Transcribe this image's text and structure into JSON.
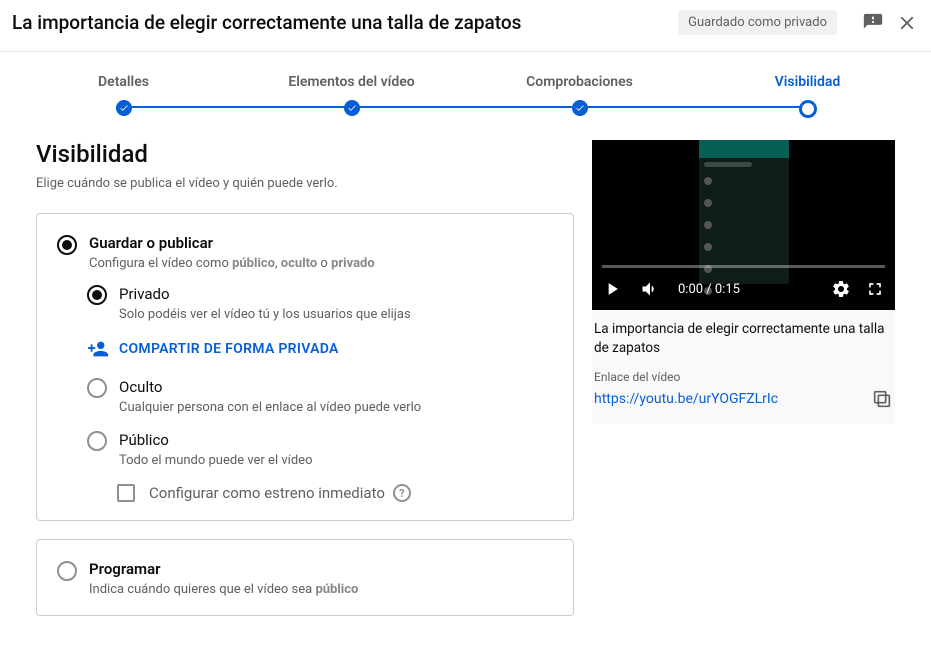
{
  "header": {
    "title": "La importancia de elegir correctamente una talla de zapatos",
    "saved_chip": "Guardado como privado"
  },
  "stepper": {
    "steps": [
      {
        "label": "Detalles"
      },
      {
        "label": "Elementos del vídeo"
      },
      {
        "label": "Comprobaciones"
      },
      {
        "label": "Visibilidad"
      }
    ]
  },
  "visibility": {
    "heading": "Visibilidad",
    "subheading": "Elige cuándo se publica el vídeo y quién puede verlo.",
    "save_publish": {
      "title": "Guardar o publicar",
      "sub_pre": "Configura el vídeo como ",
      "bold1": "público",
      "sep1": ", ",
      "bold2": "oculto",
      "sep2": " o ",
      "bold3": "privado"
    },
    "private": {
      "label": "Privado",
      "sub": "Solo podéis ver el vídeo tú y los usuarios que elijas"
    },
    "share_private": "COMPARTIR DE FORMA PRIVADA",
    "unlisted": {
      "label": "Oculto",
      "sub": "Cualquier persona con el enlace al vídeo puede verlo"
    },
    "public": {
      "label": "Público",
      "sub": "Todo el mundo puede ver el vídeo"
    },
    "premiere": "Configurar como estreno inmediato",
    "schedule": {
      "title": "Programar",
      "sub_pre": "Indica cuándo quieres que el vídeo sea ",
      "bold": "público"
    }
  },
  "preview": {
    "time": "0:00 / 0:15",
    "video_title": "La importancia de elegir correctamente una talla de zapatos",
    "link_label": "Enlace del vídeo",
    "url": "https://youtu.be/urYOGFZLrIc"
  }
}
